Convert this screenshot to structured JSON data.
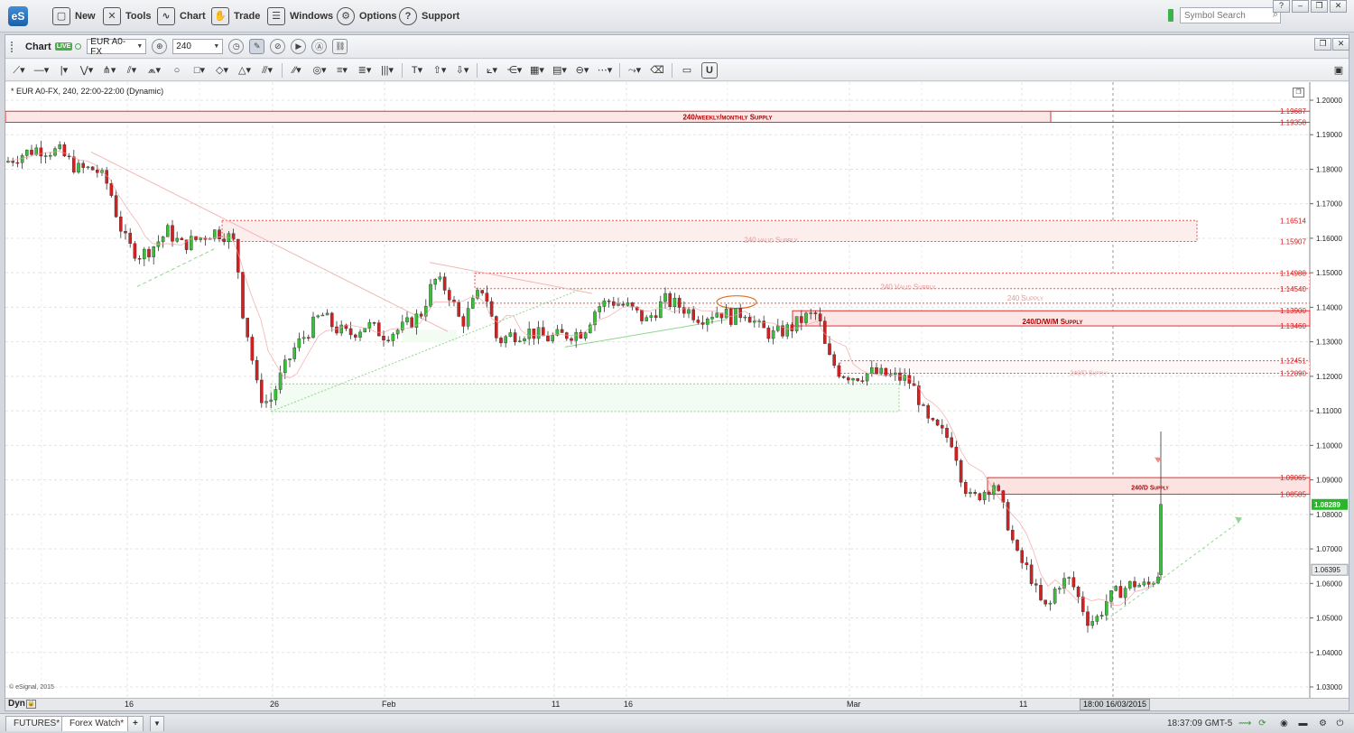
{
  "menubar": {
    "logo": "eS",
    "items": [
      {
        "label": "New",
        "icon": "new-window-icon",
        "glyph": "▢"
      },
      {
        "label": "Tools",
        "icon": "tools-icon",
        "glyph": "✕"
      },
      {
        "label": "Chart",
        "icon": "chart-icon",
        "glyph": "∿"
      },
      {
        "label": "Trade",
        "icon": "trade-icon",
        "glyph": "✋"
      },
      {
        "label": "Windows",
        "icon": "windows-icon",
        "glyph": "☰"
      },
      {
        "label": "Options",
        "icon": "gear-icon",
        "glyph": "⚙"
      },
      {
        "label": "Support",
        "icon": "help-icon",
        "glyph": "?"
      }
    ],
    "symbol_search_placeholder": "Symbol Search"
  },
  "chart_toolbar": {
    "label": "Chart",
    "live": "LIVE",
    "symbol": "EUR A0-FX",
    "interval": "240"
  },
  "chart_caption": "* EUR A0-FX, 240, 22:00-22:00 (Dynamic)",
  "copyright": "© eSignal, 2015",
  "xaxis": {
    "dyn_label": "Dyn",
    "ticks": [
      "16",
      "26",
      "Feb",
      "11",
      "16",
      "Mar",
      "11"
    ],
    "cursor_label": "18:00 16/03/2015"
  },
  "yaxis_ticks": [
    "1.20000",
    "1.19000",
    "1.18000",
    "1.17000",
    "1.16000",
    "1.15000",
    "1.14000",
    "1.13000",
    "1.12000",
    "1.11000",
    "1.10000",
    "1.09000",
    "1.08000",
    "1.07000",
    "1.06000",
    "1.05000",
    "1.04000",
    "1.03000"
  ],
  "zones": [
    {
      "label": "240/weekly/monthly Supply",
      "top": "1.19687",
      "bottom": "1.19358"
    },
    {
      "label": "240 valid Supply",
      "top": "1.16514",
      "bottom": "1.15907"
    },
    {
      "label": "240 Valid Supply",
      "top": "1.14988",
      "bottom": "1.14540"
    },
    {
      "label": "240 Supply",
      "top": "",
      "bottom": ""
    },
    {
      "label": "240/D/W/M Supply",
      "top": "1.13900",
      "bottom": "1.13460"
    },
    {
      "label": "240/D Supply",
      "top": "1.12451",
      "bottom": "1.12090"
    },
    {
      "label": "240/D Supply",
      "top": "1.09065",
      "bottom": "1.08585"
    }
  ],
  "price_badges": {
    "current": "1.08289",
    "crosshair": "1.06395"
  },
  "chart_data": {
    "type": "candlestick",
    "series_name": "EUR A0-FX 240",
    "ylim": [
      1.025,
      1.205
    ],
    "grid": true,
    "approx_close_path": [
      [
        0,
        1.182
      ],
      [
        15,
        1.184
      ],
      [
        35,
        1.186
      ],
      [
        60,
        1.185
      ],
      [
        80,
        1.18
      ],
      [
        100,
        1.18
      ],
      [
        115,
        1.175
      ],
      [
        125,
        1.165
      ],
      [
        135,
        1.158
      ],
      [
        150,
        1.155
      ],
      [
        165,
        1.158
      ],
      [
        180,
        1.162
      ],
      [
        195,
        1.158
      ],
      [
        215,
        1.16
      ],
      [
        230,
        1.162
      ],
      [
        245,
        1.161
      ],
      [
        255,
        1.158
      ],
      [
        262,
        1.14
      ],
      [
        270,
        1.13
      ],
      [
        280,
        1.115
      ],
      [
        292,
        1.112
      ],
      [
        305,
        1.12
      ],
      [
        320,
        1.128
      ],
      [
        335,
        1.133
      ],
      [
        350,
        1.138
      ],
      [
        365,
        1.134
      ],
      [
        380,
        1.132
      ],
      [
        400,
        1.135
      ],
      [
        420,
        1.132
      ],
      [
        440,
        1.134
      ],
      [
        460,
        1.138
      ],
      [
        475,
        1.148
      ],
      [
        490,
        1.145
      ],
      [
        505,
        1.135
      ],
      [
        520,
        1.142
      ],
      [
        530,
        1.146
      ],
      [
        545,
        1.13
      ],
      [
        560,
        1.132
      ],
      [
        580,
        1.133
      ],
      [
        600,
        1.131
      ],
      [
        620,
        1.132
      ],
      [
        640,
        1.133
      ],
      [
        655,
        1.14
      ],
      [
        670,
        1.142
      ],
      [
        690,
        1.14
      ],
      [
        710,
        1.136
      ],
      [
        730,
        1.142
      ],
      [
        750,
        1.14
      ],
      [
        770,
        1.137
      ],
      [
        790,
        1.139
      ],
      [
        805,
        1.137
      ],
      [
        820,
        1.139
      ],
      [
        835,
        1.134
      ],
      [
        850,
        1.132
      ],
      [
        870,
        1.134
      ],
      [
        885,
        1.137
      ],
      [
        900,
        1.138
      ],
      [
        910,
        1.126
      ],
      [
        925,
        1.121
      ],
      [
        940,
        1.12
      ],
      [
        960,
        1.121
      ],
      [
        980,
        1.12
      ],
      [
        1000,
        1.119
      ],
      [
        1010,
        1.115
      ],
      [
        1020,
        1.107
      ],
      [
        1035,
        1.104
      ],
      [
        1050,
        1.101
      ],
      [
        1060,
        1.09
      ],
      [
        1070,
        1.084
      ],
      [
        1085,
        1.087
      ],
      [
        1095,
        1.089
      ],
      [
        1110,
        1.078
      ],
      [
        1120,
        1.068
      ],
      [
        1135,
        1.063
      ],
      [
        1145,
        1.055
      ],
      [
        1155,
        1.052
      ],
      [
        1165,
        1.06
      ],
      [
        1180,
        1.061
      ],
      [
        1190,
        1.055
      ],
      [
        1200,
        1.049
      ],
      [
        1210,
        1.05
      ],
      [
        1220,
        1.055
      ],
      [
        1235,
        1.058
      ],
      [
        1250,
        1.06
      ],
      [
        1265,
        1.059
      ],
      [
        1277,
        1.063
      ],
      [
        1283,
        1.083
      ]
    ]
  }
}
